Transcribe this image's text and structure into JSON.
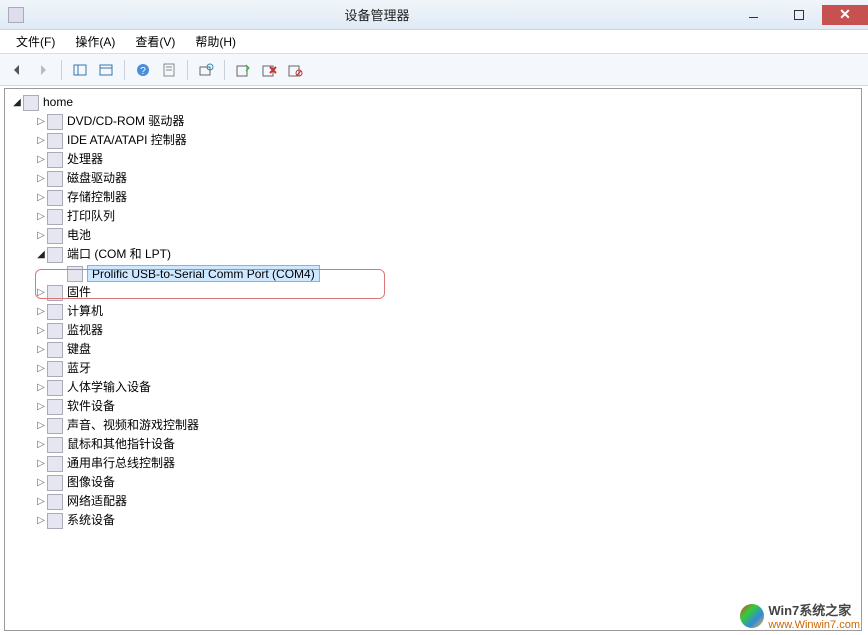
{
  "window": {
    "title": "设备管理器"
  },
  "menus": {
    "file": "文件(F)",
    "action": "操作(A)",
    "view": "查看(V)",
    "help": "帮助(H)"
  },
  "tree": {
    "root": "home",
    "items": [
      {
        "label": "DVD/CD-ROM 驱动器"
      },
      {
        "label": "IDE ATA/ATAPI 控制器"
      },
      {
        "label": "处理器"
      },
      {
        "label": "磁盘驱动器"
      },
      {
        "label": "存储控制器"
      },
      {
        "label": "打印队列"
      },
      {
        "label": "电池"
      },
      {
        "label": "端口 (COM 和 LPT)",
        "expanded": true,
        "children": [
          {
            "label": "Prolific USB-to-Serial Comm Port (COM4)",
            "selected": true
          }
        ]
      },
      {
        "label": "固件"
      },
      {
        "label": "计算机"
      },
      {
        "label": "监视器"
      },
      {
        "label": "键盘"
      },
      {
        "label": "蓝牙"
      },
      {
        "label": "人体学输入设备"
      },
      {
        "label": "软件设备"
      },
      {
        "label": "声音、视频和游戏控制器"
      },
      {
        "label": "鼠标和其他指针设备"
      },
      {
        "label": "通用串行总线控制器"
      },
      {
        "label": "图像设备"
      },
      {
        "label": "网络适配器"
      },
      {
        "label": "系统设备"
      }
    ]
  },
  "watermark": {
    "name": "Win7系统之家",
    "url": "www.Winwin7.com"
  }
}
